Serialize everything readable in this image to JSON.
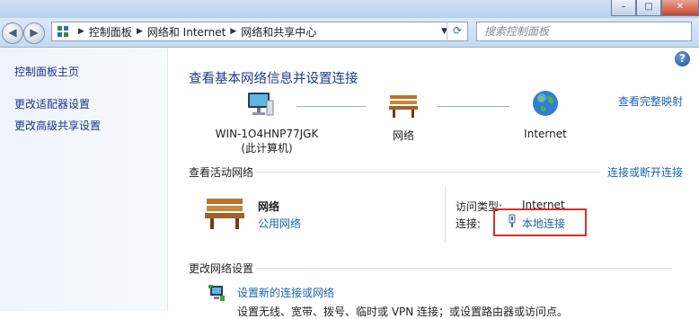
{
  "window": {
    "minimize_glyph": "–",
    "maximize_glyph": "□",
    "close_glyph": "✕"
  },
  "address": {
    "crumbs": [
      "控制面板",
      "网络和 Internet",
      "网络和共享中心"
    ],
    "search_placeholder": "搜索控制面板"
  },
  "sidebar": {
    "items": [
      {
        "label": "控制面板主页"
      },
      {
        "label": "更改适配器设置"
      },
      {
        "label": "更改高级共享设置"
      }
    ]
  },
  "main": {
    "title": "查看基本网络信息并设置连接",
    "view_full_map": "查看完整映射",
    "map": {
      "computer_name": "WIN-1O4HNP77JGK",
      "computer_sub": "(此计算机)",
      "network": "网络",
      "internet": "Internet"
    },
    "active": {
      "header": "查看活动网络",
      "connect_disconnect": "连接或断开连接",
      "network_name": "网络",
      "network_type": "公用网络",
      "access_type_label": "访问类型:",
      "access_type_value": "Internet",
      "connection_label": "连接:",
      "connection_value": "本地连接"
    },
    "change": {
      "header": "更改网络设置",
      "setup_link": "设置新的连接或网络",
      "setup_desc": "设置无线、宽带、拨号、临时或 VPN 连接；或设置路由器或访问点。"
    }
  }
}
